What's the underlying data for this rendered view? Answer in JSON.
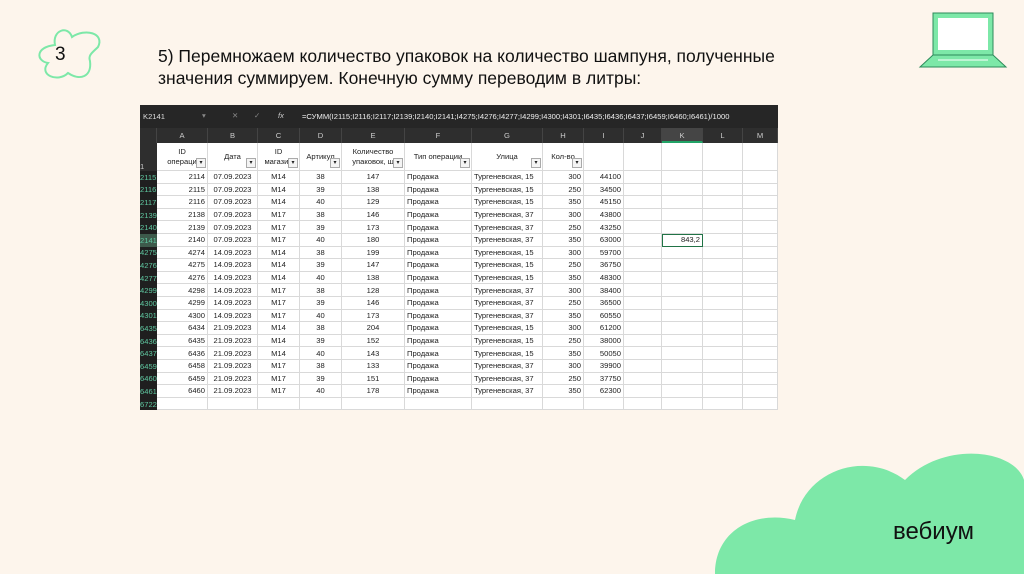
{
  "slide": {
    "number": "3",
    "title": "5) Перемножаем количество упаковок на количество шампуня, полученные значения суммируем. Конечную сумму переводим в литры:",
    "brand": "вебиум",
    "accent": "#7de8a8"
  },
  "sheet": {
    "name_box": "K2141",
    "formula": "=СУММ(I2115;I2116;I2117;I2139;I2140;I2141;I4275;I4276;I4277;I4299;I4300;I4301;I6435;I6436;I6437;I6459;I6460;I6461)/1000",
    "columns": [
      "A",
      "B",
      "C",
      "D",
      "E",
      "F",
      "G",
      "H",
      "I",
      "J",
      "K",
      "L",
      "M"
    ],
    "header_row_num": "1",
    "headers": [
      [
        "ID",
        "операци"
      ],
      [
        "Дата"
      ],
      [
        "ID",
        "магазин"
      ],
      [
        "Артикул"
      ],
      [
        "Количество",
        "упаковок, ш"
      ],
      [
        "Тип операции"
      ],
      [
        "Улица"
      ],
      [
        "Кол-во"
      ]
    ],
    "rows": [
      [
        "2115",
        "2114",
        "07.09.2023",
        "M14",
        "38",
        "147",
        "Продажа",
        "Тургеневская, 15",
        "300",
        "44100"
      ],
      [
        "2116",
        "2115",
        "07.09.2023",
        "M14",
        "39",
        "138",
        "Продажа",
        "Тургеневская, 15",
        "250",
        "34500"
      ],
      [
        "2117",
        "2116",
        "07.09.2023",
        "M14",
        "40",
        "129",
        "Продажа",
        "Тургеневская, 15",
        "350",
        "45150"
      ],
      [
        "2139",
        "2138",
        "07.09.2023",
        "M17",
        "38",
        "146",
        "Продажа",
        "Тургеневская, 37",
        "300",
        "43800"
      ],
      [
        "2140",
        "2139",
        "07.09.2023",
        "M17",
        "39",
        "173",
        "Продажа",
        "Тургеневская, 37",
        "250",
        "43250"
      ],
      [
        "2141",
        "2140",
        "07.09.2023",
        "M17",
        "40",
        "180",
        "Продажа",
        "Тургеневская, 37",
        "350",
        "63000"
      ],
      [
        "4275",
        "4274",
        "14.09.2023",
        "M14",
        "38",
        "199",
        "Продажа",
        "Тургеневская, 15",
        "300",
        "59700"
      ],
      [
        "4276",
        "4275",
        "14.09.2023",
        "M14",
        "39",
        "147",
        "Продажа",
        "Тургеневская, 15",
        "250",
        "36750"
      ],
      [
        "4277",
        "4276",
        "14.09.2023",
        "M14",
        "40",
        "138",
        "Продажа",
        "Тургеневская, 15",
        "350",
        "48300"
      ],
      [
        "4299",
        "4298",
        "14.09.2023",
        "M17",
        "38",
        "128",
        "Продажа",
        "Тургеневская, 37",
        "300",
        "38400"
      ],
      [
        "4300",
        "4299",
        "14.09.2023",
        "M17",
        "39",
        "146",
        "Продажа",
        "Тургеневская, 37",
        "250",
        "36500"
      ],
      [
        "4301",
        "4300",
        "14.09.2023",
        "M17",
        "40",
        "173",
        "Продажа",
        "Тургеневская, 37",
        "350",
        "60550"
      ],
      [
        "6435",
        "6434",
        "21.09.2023",
        "M14",
        "38",
        "204",
        "Продажа",
        "Тургеневская, 15",
        "300",
        "61200"
      ],
      [
        "6436",
        "6435",
        "21.09.2023",
        "M14",
        "39",
        "152",
        "Продажа",
        "Тургеневская, 15",
        "250",
        "38000"
      ],
      [
        "6437",
        "6436",
        "21.09.2023",
        "M14",
        "40",
        "143",
        "Продажа",
        "Тургеневская, 15",
        "350",
        "50050"
      ],
      [
        "6459",
        "6458",
        "21.09.2023",
        "M17",
        "38",
        "133",
        "Продажа",
        "Тургеневская, 37",
        "300",
        "39900"
      ],
      [
        "6460",
        "6459",
        "21.09.2023",
        "M17",
        "39",
        "151",
        "Продажа",
        "Тургеневская, 37",
        "250",
        "37750"
      ],
      [
        "6461",
        "6460",
        "21.09.2023",
        "M17",
        "40",
        "178",
        "Продажа",
        "Тургеневская, 37",
        "350",
        "62300"
      ],
      [
        "6722",
        "",
        "",
        "",
        "",
        "",
        "",
        "",
        "",
        ""
      ]
    ],
    "result_row": "2141",
    "result_value": "843,2"
  }
}
